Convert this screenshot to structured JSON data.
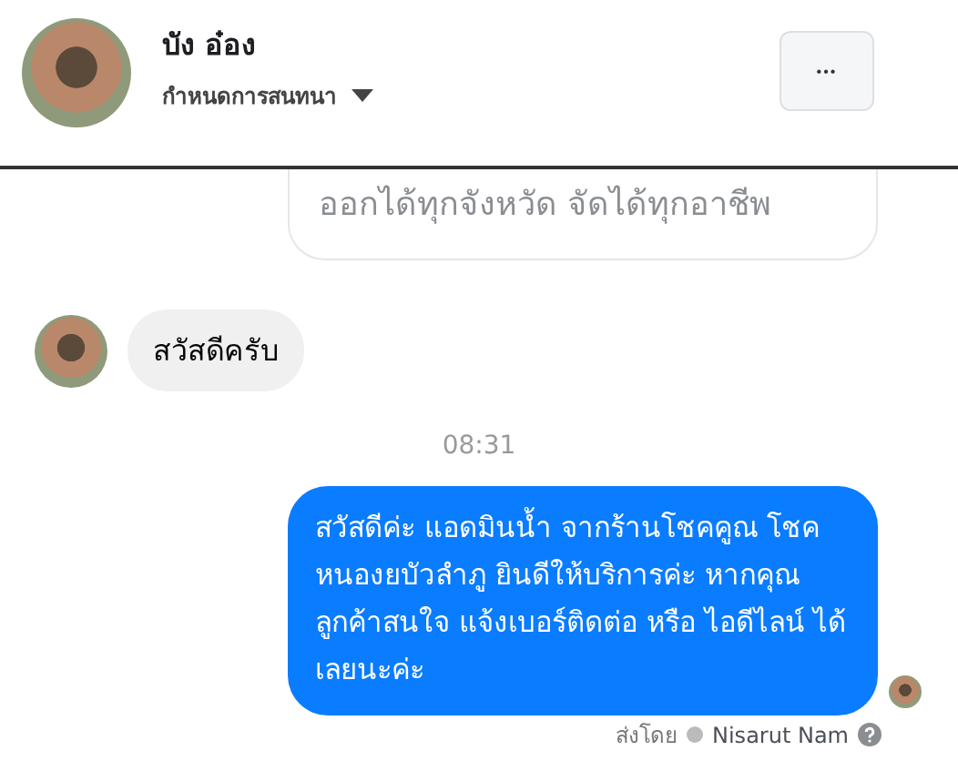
{
  "header": {
    "name": "บัง อ๋อง",
    "subtitle": "กำหนดการสนทนา",
    "more_button": "•••"
  },
  "messages": [
    {
      "kind": "card",
      "text": "ออกได้ทุกจังหวัด จัดได้ทุกอาชีพ"
    },
    {
      "kind": "incoming",
      "text": "สวัสดีครับ"
    },
    {
      "kind": "time",
      "text": "08:31"
    },
    {
      "kind": "outgoing",
      "text": "สวัสดีค่ะ แอดมินน้ำ จากร้านโชคคูณ โชคหนองยบัวลำภู ยินดีให้บริการค่ะ หากคุณลูกค้าสนใจ แจ้งเบอร์ติดต่อ หรือ ไอดีไลน์ ได้เลยนะค่ะ"
    }
  ],
  "sent_by": {
    "label": "ส่งโดย",
    "name": "Nisarut Nam"
  }
}
